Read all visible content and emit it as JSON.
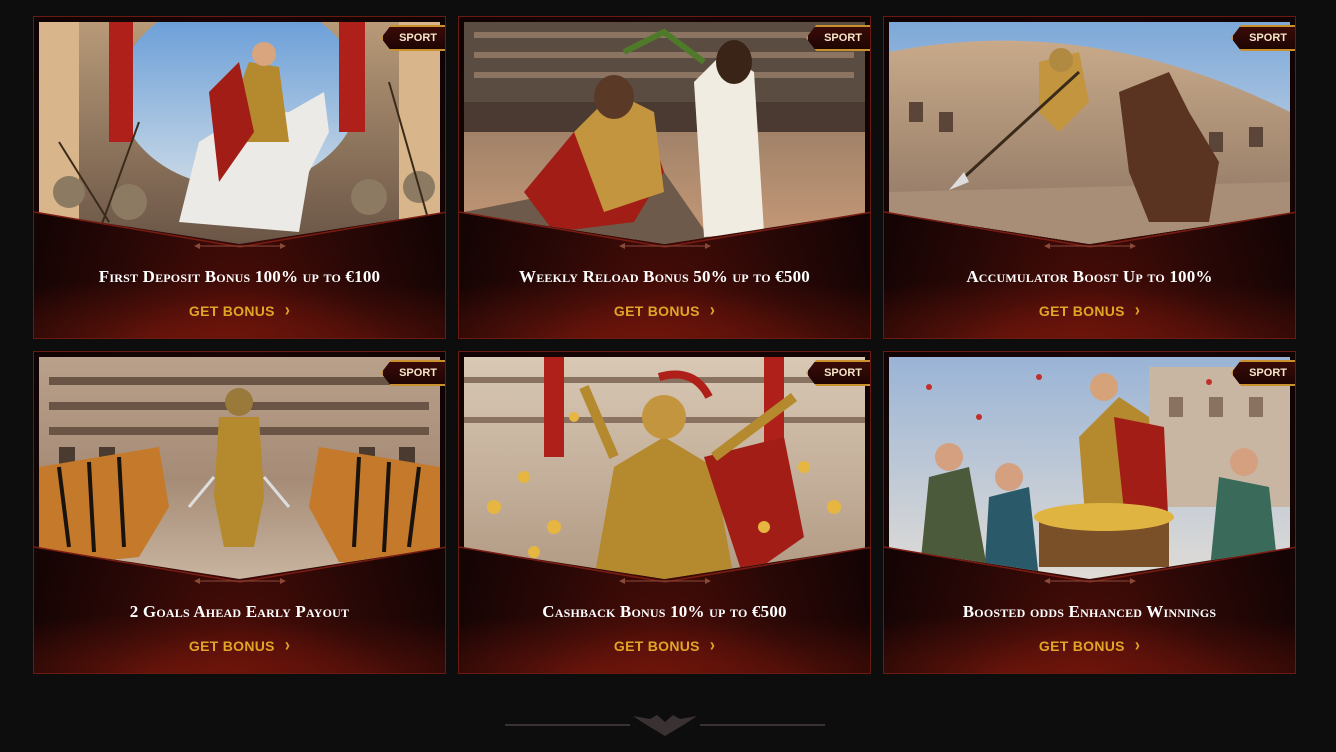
{
  "colors": {
    "accent_gold": "#e0a526",
    "card_border": "#6b1a12",
    "badge_border": "#c9912e",
    "background": "#0e0d0d"
  },
  "promotions": [
    {
      "badge": "SPORT",
      "title": "First Deposit Bonus 100% up to €100",
      "cta": "GET BONUS"
    },
    {
      "badge": "SPORT",
      "title": "Weekly Reload Bonus 50% up to €500",
      "cta": "GET BONUS"
    },
    {
      "badge": "SPORT",
      "title": "Accumulator Boost Up to 100%",
      "cta": "GET BONUS"
    },
    {
      "badge": "SPORT",
      "title": "2 Goals Ahead Early Payout",
      "cta": "GET BONUS"
    },
    {
      "badge": "SPORT",
      "title": "Cashback Bonus 10% up to €500",
      "cta": "GET BONUS"
    },
    {
      "badge": "SPORT",
      "title": "Boosted odds Enhanced Winnings",
      "cta": "GET BONUS"
    }
  ],
  "icons": {
    "cta_arrow": "chevron-right-icon",
    "footer": "winged-emblem-icon"
  }
}
